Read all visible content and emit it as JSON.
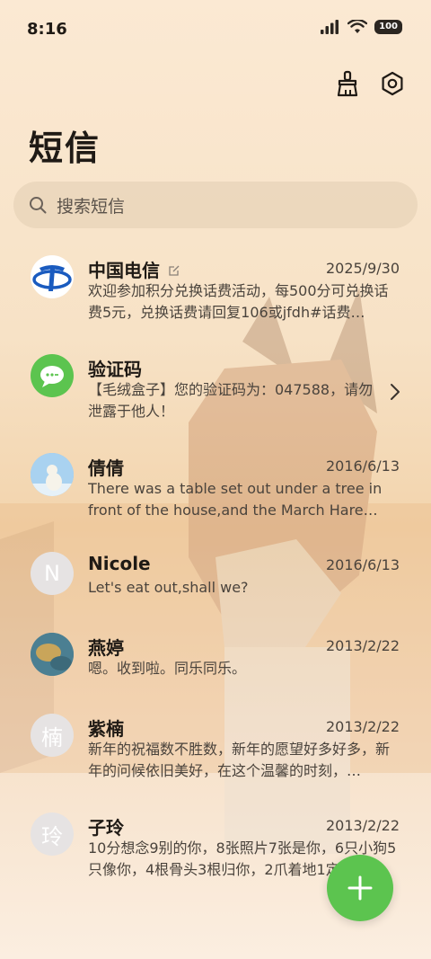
{
  "status": {
    "time": "8:16",
    "battery": "100"
  },
  "header": {
    "title": "短信"
  },
  "search": {
    "placeholder": "搜索短信"
  },
  "messages": [
    {
      "name": "中国电信",
      "date": "2025/9/30",
      "preview": "欢迎参加积分兑换话费活动，每500分可兑换话费5元，兑换话费请回复106或jfdh#话费…",
      "avatar": "telecom-logo"
    },
    {
      "name": "验证码",
      "date": "",
      "preview": "【毛绒盒子】您的验证码为：047588，请勿泄露于他人！",
      "avatar": "message-bubble"
    },
    {
      "name": "倩倩",
      "date": "2016/6/13",
      "preview": "There was a table set out under a tree in front of the house,and the March Hare an…",
      "avatar": "polar-bear-photo"
    },
    {
      "name": "Nicole",
      "date": "2016/6/13",
      "preview": "Let's eat out,shall we?",
      "avatar": "N"
    },
    {
      "name": "燕婷",
      "date": "2013/2/22",
      "preview": "嗯。收到啦。同乐同乐。",
      "avatar": "landscape-photo"
    },
    {
      "name": "紫楠",
      "date": "2013/2/22",
      "preview": "新年的祝福数不胜数，新年的愿望好多好多，新年的问候依旧美好，在这个温馨的时刻，…",
      "avatar": "楠"
    },
    {
      "name": "子玲",
      "date": "2013/2/22",
      "preview": "10分想念9别的你，8张照片7张是你，6只小狗5只像你，4根骨头3根归你，2爪着地1定…",
      "avatar": "玲"
    }
  ],
  "colors": {
    "accent": "#5cc44f",
    "telecom_blue": "#1a5bbf"
  }
}
